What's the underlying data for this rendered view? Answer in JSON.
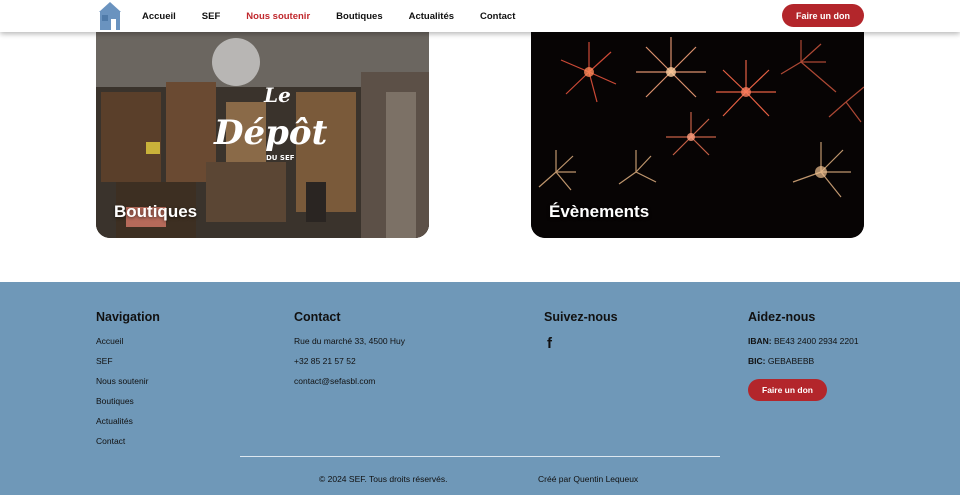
{
  "header": {
    "logo_icon": "house-icon",
    "nav": [
      {
        "label": "Accueil",
        "active": false
      },
      {
        "label": "SEF",
        "active": false
      },
      {
        "label": "Nous soutenir",
        "active": true
      },
      {
        "label": "Boutiques",
        "active": false
      },
      {
        "label": "Actualités",
        "active": false
      },
      {
        "label": "Contact",
        "active": false
      }
    ],
    "donate_label": "Faire un don"
  },
  "cards": [
    {
      "title": "Boutiques",
      "logo_top": "Le",
      "logo_main": "Dépôt",
      "logo_sub": "DU SEF"
    },
    {
      "title": "Évènements"
    }
  ],
  "footer": {
    "navigation": {
      "heading": "Navigation",
      "links": [
        "Accueil",
        "SEF",
        "Nous soutenir",
        "Boutiques",
        "Actualités",
        "Contact"
      ]
    },
    "contact": {
      "heading": "Contact",
      "address": "Rue du marché 33, 4500 Huy",
      "phone": "+32 85 21 57 52",
      "email": "contact@sefasbl.com"
    },
    "social": {
      "heading": "Suivez-nous",
      "facebook_icon": "facebook-icon",
      "facebook_glyph": "f"
    },
    "help": {
      "heading": "Aidez-nous",
      "iban_label": "IBAN:",
      "iban_value": "BE43 2400 2934 2201",
      "bic_label": "BIC:",
      "bic_value": "GEBABEBB",
      "donate_label": "Faire un don"
    },
    "copyright": "© 2024 SEF. Tous droits réservés.",
    "credit": "Créé par Quentin Lequeux"
  },
  "colors": {
    "accent": "#b3262b",
    "active_nav": "#c0282d",
    "footer_bg": "#6f98b8",
    "logo": "#6a93bf"
  }
}
